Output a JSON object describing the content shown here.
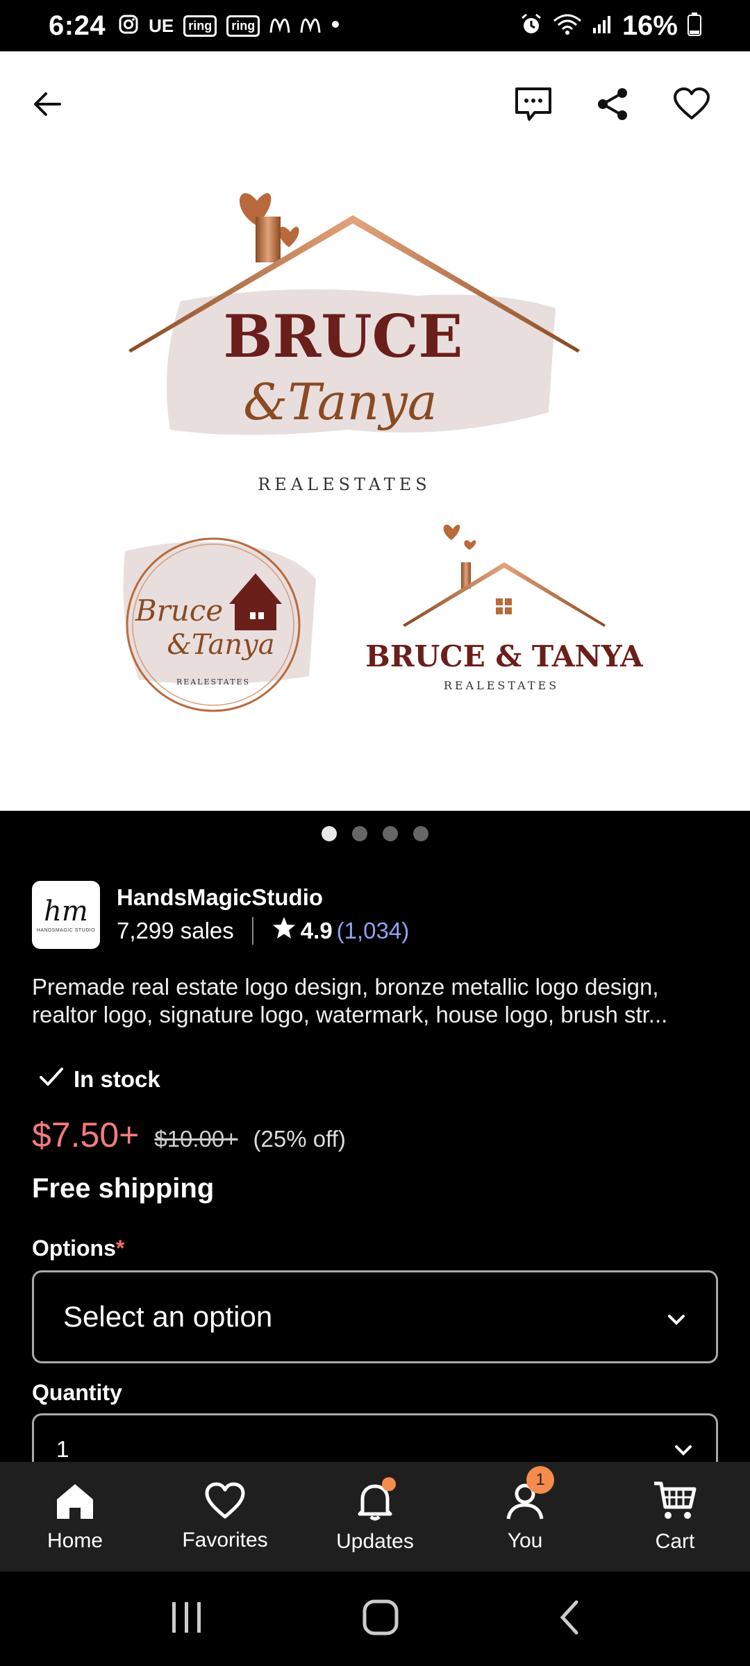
{
  "status_bar": {
    "time": "6:24",
    "left_icons": [
      "instagram-icon",
      "UE",
      "ring",
      "ring",
      "mcdonalds-icon",
      "mcdonalds-icon",
      "dot"
    ],
    "battery": "16%"
  },
  "hero_image": {
    "logo_main_line1": "BRUCE",
    "logo_main_line2": "&Tanya",
    "logo_main_sub": "REALESTATES",
    "logo_badge_line1": "Bruce",
    "logo_badge_line2": "&Tanya",
    "logo_badge_sub": "REALESTATES",
    "logo_small_line": "BRUCE & TANYA",
    "logo_small_sub": "REALESTATES"
  },
  "carousel": {
    "count": 4,
    "active": 0
  },
  "shop": {
    "avatar_text": "hm",
    "avatar_sub": "HANDSMAGIC STUDIO",
    "name": "HandsMagicStudio",
    "sales": "7,299 sales",
    "rating": "4.9",
    "reviews": "(1,034)"
  },
  "listing": {
    "title": "Premade real estate logo design, bronze metallic logo design, realtor logo, signature logo, watermark, house logo, brush str...",
    "stock": "In stock",
    "price": "$7.50+",
    "old_price": "$10.00+",
    "discount": "(25% off)",
    "shipping": "Free shipping"
  },
  "options": {
    "label": "Options",
    "required_mark": "*",
    "selected": "Select an option"
  },
  "quantity": {
    "label": "Quantity",
    "value": "1"
  },
  "bottom_nav": [
    {
      "label": "Home",
      "icon": "home-icon"
    },
    {
      "label": "Favorites",
      "icon": "heart-icon"
    },
    {
      "label": "Updates",
      "icon": "bell-icon"
    },
    {
      "label": "You",
      "icon": "user-icon",
      "badge": "1"
    },
    {
      "label": "Cart",
      "icon": "cart-icon"
    }
  ],
  "colors": {
    "price": "#f27c7c",
    "reviews_link": "#8fa3f2",
    "badge": "#f58b4c",
    "bronze": "#b86a3c",
    "maroon": "#6b1f1a"
  }
}
